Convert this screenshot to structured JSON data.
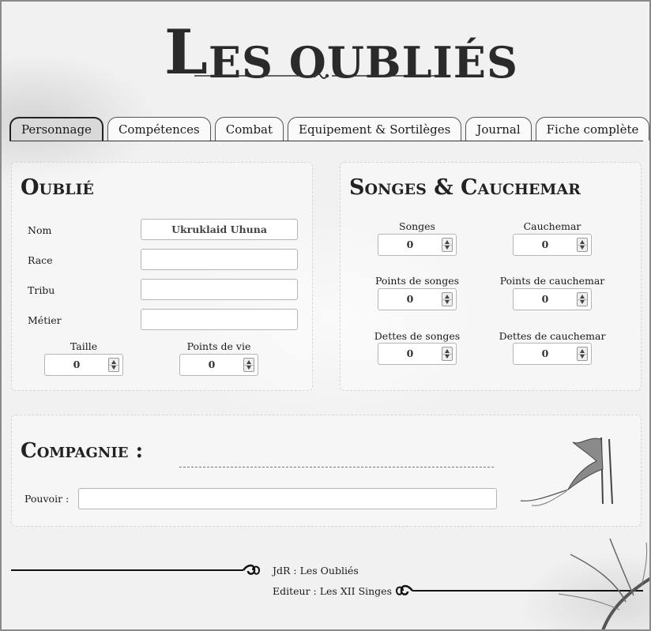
{
  "logo": {
    "first": "L",
    "rest": "ES OUBLIÉS"
  },
  "tabs": [
    {
      "label": "Personnage",
      "active": true
    },
    {
      "label": "Compétences",
      "active": false
    },
    {
      "label": "Combat",
      "active": false
    },
    {
      "label": "Equipement & Sortilèges",
      "active": false
    },
    {
      "label": "Journal",
      "active": false
    },
    {
      "label": "Fiche complète",
      "active": false
    }
  ],
  "oublie": {
    "title": "Oublié",
    "fields": [
      {
        "label": "Nom",
        "value": "Ukruklaid Uhuna"
      },
      {
        "label": "Race",
        "value": ""
      },
      {
        "label": "Tribu",
        "value": ""
      },
      {
        "label": "Métier",
        "value": ""
      }
    ],
    "numbers": [
      {
        "label": "Taille",
        "value": "0"
      },
      {
        "label": "Points de vie",
        "value": "0"
      }
    ]
  },
  "songes": {
    "title": "Songes & Cauchemar",
    "numbers": [
      {
        "label": "Songes",
        "value": "0"
      },
      {
        "label": "Cauchemar",
        "value": "0"
      },
      {
        "label": "Points de songes",
        "value": "0"
      },
      {
        "label": "Points de cauchemar",
        "value": "0"
      },
      {
        "label": "Dettes de songes",
        "value": "0"
      },
      {
        "label": "Dettes de cauchemar",
        "value": "0"
      }
    ]
  },
  "compagnie": {
    "title": "Compagnie :",
    "name_value": "",
    "pouvoir_label": "Pouvoir :",
    "pouvoir_value": ""
  },
  "footer": {
    "line1": "JdR : Les Oubliés",
    "line2": "Editeur : Les XII Singes"
  },
  "icons": {
    "banner": "banner-flag-icon",
    "ornament": "scroll-ornament-icon",
    "branch": "dead-branch-icon"
  }
}
